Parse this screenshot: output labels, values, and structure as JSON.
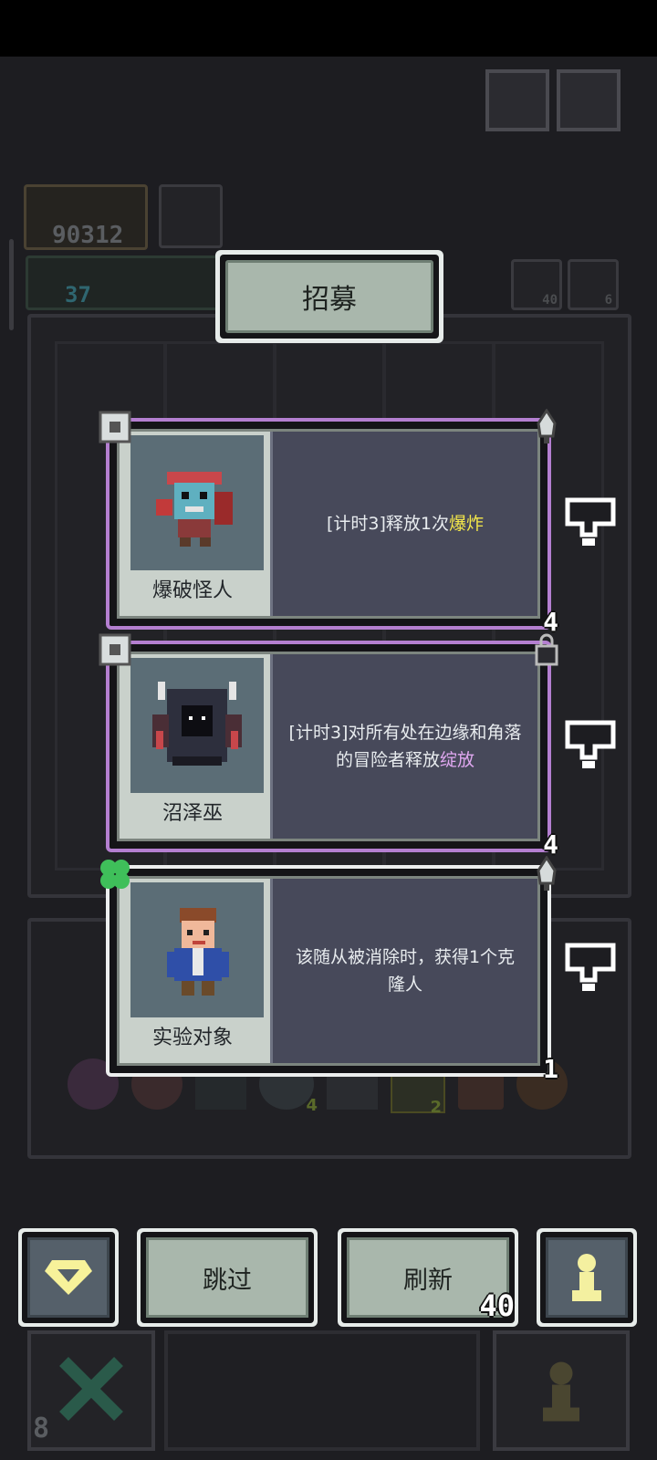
{
  "title": "招募",
  "background": {
    "gold": "90312",
    "gems": "37",
    "slot_count_a": "40",
    "slot_count_b": "6",
    "hidden_count": "8",
    "item_badges": [
      "4",
      "2"
    ]
  },
  "cards": [
    {
      "name": "爆破怪人",
      "desc_prefix": "[计时3]释放1次",
      "desc_keyword": "爆炸",
      "keyword_color": "#f4e84a",
      "level": "4",
      "rarity_color": "#b47fd0",
      "corner_icon": "dagger-icon"
    },
    {
      "name": "沼泽巫",
      "desc_prefix": "[计时3]对所有处在边缘和角落的冒险者释放",
      "desc_keyword": "绽放",
      "keyword_color": "#e0a8f0",
      "level": "4",
      "rarity_color": "#b47fd0",
      "corner_icon": "lock-icon"
    },
    {
      "name": "实验对象",
      "desc_prefix": "该随从被消除时，获得1个克隆人",
      "desc_keyword": "",
      "keyword_color": "#ffffff",
      "level": "1",
      "rarity_color": "#eceeee",
      "corner_icon": "dagger-icon"
    }
  ],
  "buttons": {
    "skip": "跳过",
    "refresh": "刷新",
    "refresh_cost": "40"
  },
  "colors": {
    "gem_yellow": "#f7f29a",
    "pawn_yellow": "#f4f0a0",
    "clover_green": "#3fbf5a"
  }
}
